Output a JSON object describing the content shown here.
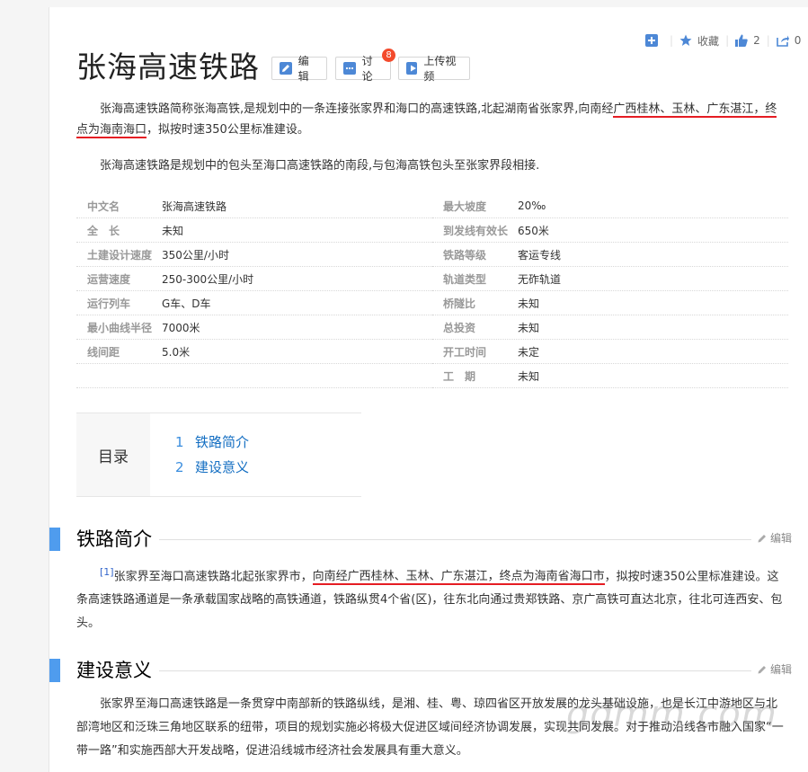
{
  "toolbar": {
    "add_label": "",
    "favorite_label": "收藏",
    "like_count": "2",
    "share_count": "0"
  },
  "title": "张海高速铁路",
  "title_buttons": {
    "edit": "编辑",
    "discuss": "讨论",
    "discuss_badge": "8",
    "upload_video": "上传视频"
  },
  "summary": {
    "p1_plain": "张海高速铁路简称张海高铁,是规划中的一条连接张家界和海口的高速铁路,北起湖南省张家界,向南经",
    "p1_hl1": "广西桂林、玉林、广东",
    "p1_hl2": "湛江，终点为海南海口",
    "p1_tail": "，拟按时速350公里标准建设。",
    "p2": "张海高速铁路是规划中的包头至海口高速铁路的南段,与包海高铁包头至张家界段相接."
  },
  "info_left": [
    {
      "key": "中文名",
      "value": "张海高速铁路"
    },
    {
      "key": "全　长",
      "value": "未知"
    },
    {
      "key": "土建设计速度",
      "value": "350公里/小时"
    },
    {
      "key": "运营速度",
      "value": "250-300公里/小时"
    },
    {
      "key": "运行列车",
      "value": "G车、D车"
    },
    {
      "key": "最小曲线半径",
      "value": "7000米"
    },
    {
      "key": "线间距",
      "value": "5.0米"
    },
    {
      "key": "",
      "value": ""
    }
  ],
  "info_right": [
    {
      "key": "最大坡度",
      "value": "20‰"
    },
    {
      "key": "到发线有效长",
      "value": "650米"
    },
    {
      "key": "铁路等级",
      "value": "客运专线"
    },
    {
      "key": "轨道类型",
      "value": "无砟轨道"
    },
    {
      "key": "桥隧比",
      "value": "未知"
    },
    {
      "key": "总投资",
      "value": "未知"
    },
    {
      "key": "开工时间",
      "value": "未定"
    },
    {
      "key": "工　期",
      "value": "未知"
    }
  ],
  "catalog": {
    "title": "目录",
    "items": [
      {
        "num": "1",
        "label": "铁路简介"
      },
      {
        "num": "2",
        "label": "建设意义"
      }
    ]
  },
  "sections": [
    {
      "title": "铁路简介",
      "edit": "编辑",
      "ref": "[1]",
      "text_a": "张家界至海口高速铁路北起张家界市，",
      "text_hl": "向南经广西桂林、玉林、广东湛江，终点为海南省海口市",
      "text_b": "，拟按时速350公里标准建设。这条高速铁路通道是一条承载国家战略的高铁通道，铁路纵贯4个省(区)，往东北向通过贵郑铁路、京广高铁可直达北京，往北可连西安、包头。"
    },
    {
      "title": "建设意义",
      "edit": "编辑",
      "text": "张家界至海口高速铁路是一条贯穿中南部新的铁路纵线，是湘、桂、粤、琼四省区开放发展的龙头基础设施，也是长江中游地区与北部湾地区和泛珠三角地区联系的纽带，项目的规划实施必将极大促进区域间经济协调发展，实现共同发展。对于推动沿线各市融入国家“一带一路”和实施西部大开发战略，促进沿线城市经济社会发展具有重大意义。"
    }
  ],
  "watermark": "gdmm.com",
  "colors": {
    "accent_blue": "#4f9cee",
    "link_blue": "#136ec2",
    "badge_red": "#f34a2c",
    "underline_red": "#e51c23"
  }
}
